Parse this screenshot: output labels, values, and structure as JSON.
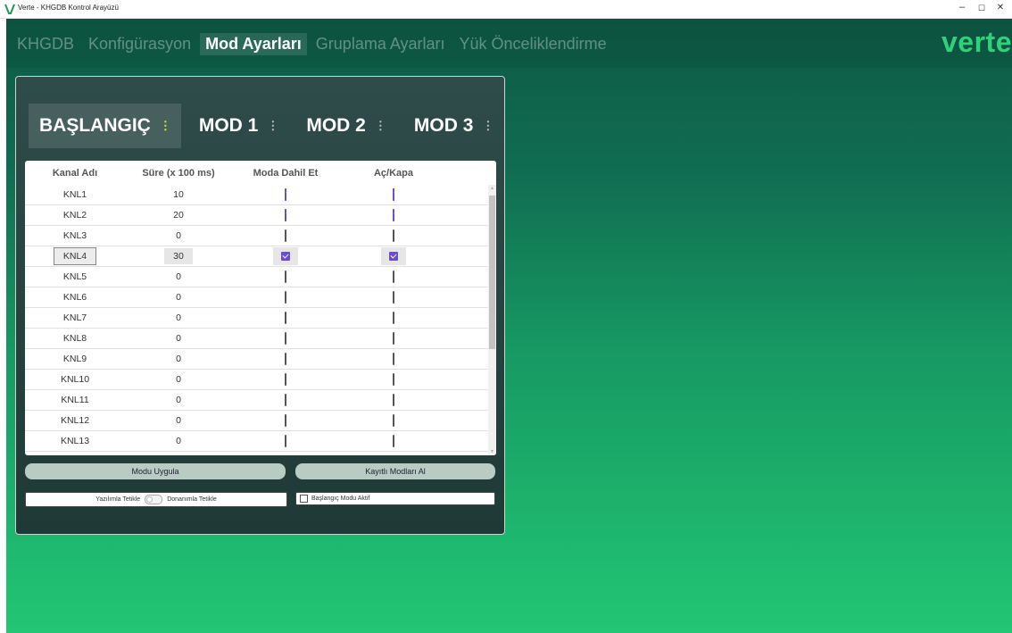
{
  "window": {
    "title": "Verte - KHGDB Kontrol Arayüzü",
    "controls": [
      "–",
      "☐",
      "✕"
    ]
  },
  "nav": {
    "items": [
      {
        "label": "KHGDB",
        "active": false
      },
      {
        "label": "Konfigürasyon",
        "active": false
      },
      {
        "label": "Mod Ayarları",
        "active": true
      },
      {
        "label": "Gruplama Ayarları",
        "active": false
      },
      {
        "label": "Yük Önceliklendirme",
        "active": false
      }
    ]
  },
  "brand": "verte",
  "colors": {
    "accent": "#2fd27a",
    "checkbox_on": "#6b4bd2",
    "button": "#b8ccc3"
  },
  "mode_tabs": [
    {
      "label": "BAŞLANGIÇ",
      "active": true
    },
    {
      "label": "MOD 1",
      "active": false
    },
    {
      "label": "MOD 2",
      "active": false
    },
    {
      "label": "MOD 3",
      "active": false
    }
  ],
  "table": {
    "headers": {
      "name": "Kanal Adı",
      "sure": "Süre (x 100 ms)",
      "dahil": "Moda Dahil Et",
      "ac": "Aç/Kapa"
    },
    "rows": [
      {
        "name": "KNL1",
        "sure": "10",
        "dahil": true,
        "ac": true
      },
      {
        "name": "KNL2",
        "sure": "20",
        "dahil": true,
        "ac": true
      },
      {
        "name": "KNL3",
        "sure": "0",
        "dahil": false,
        "ac": false
      },
      {
        "name": "KNL4",
        "sure": "30",
        "dahil": true,
        "ac": true,
        "selected": true
      },
      {
        "name": "KNL5",
        "sure": "0",
        "dahil": false,
        "ac": false
      },
      {
        "name": "KNL6",
        "sure": "0",
        "dahil": false,
        "ac": false
      },
      {
        "name": "KNL7",
        "sure": "0",
        "dahil": false,
        "ac": false
      },
      {
        "name": "KNL8",
        "sure": "0",
        "dahil": false,
        "ac": false
      },
      {
        "name": "KNL9",
        "sure": "0",
        "dahil": false,
        "ac": false
      },
      {
        "name": "KNL10",
        "sure": "0",
        "dahil": false,
        "ac": false
      },
      {
        "name": "KNL11",
        "sure": "0",
        "dahil": false,
        "ac": false
      },
      {
        "name": "KNL12",
        "sure": "0",
        "dahil": false,
        "ac": false
      },
      {
        "name": "KNL13",
        "sure": "0",
        "dahil": false,
        "ac": false
      }
    ]
  },
  "buttons": {
    "apply": "Modu Uygula",
    "fetch": "Kayıtlı Modları Al"
  },
  "trigger": {
    "software": "Yazılımla Tetikle",
    "hardware": "Donanımla Tetikle"
  },
  "start_mode": {
    "label": "Başlangıç Modu Aktif",
    "checked": false
  }
}
